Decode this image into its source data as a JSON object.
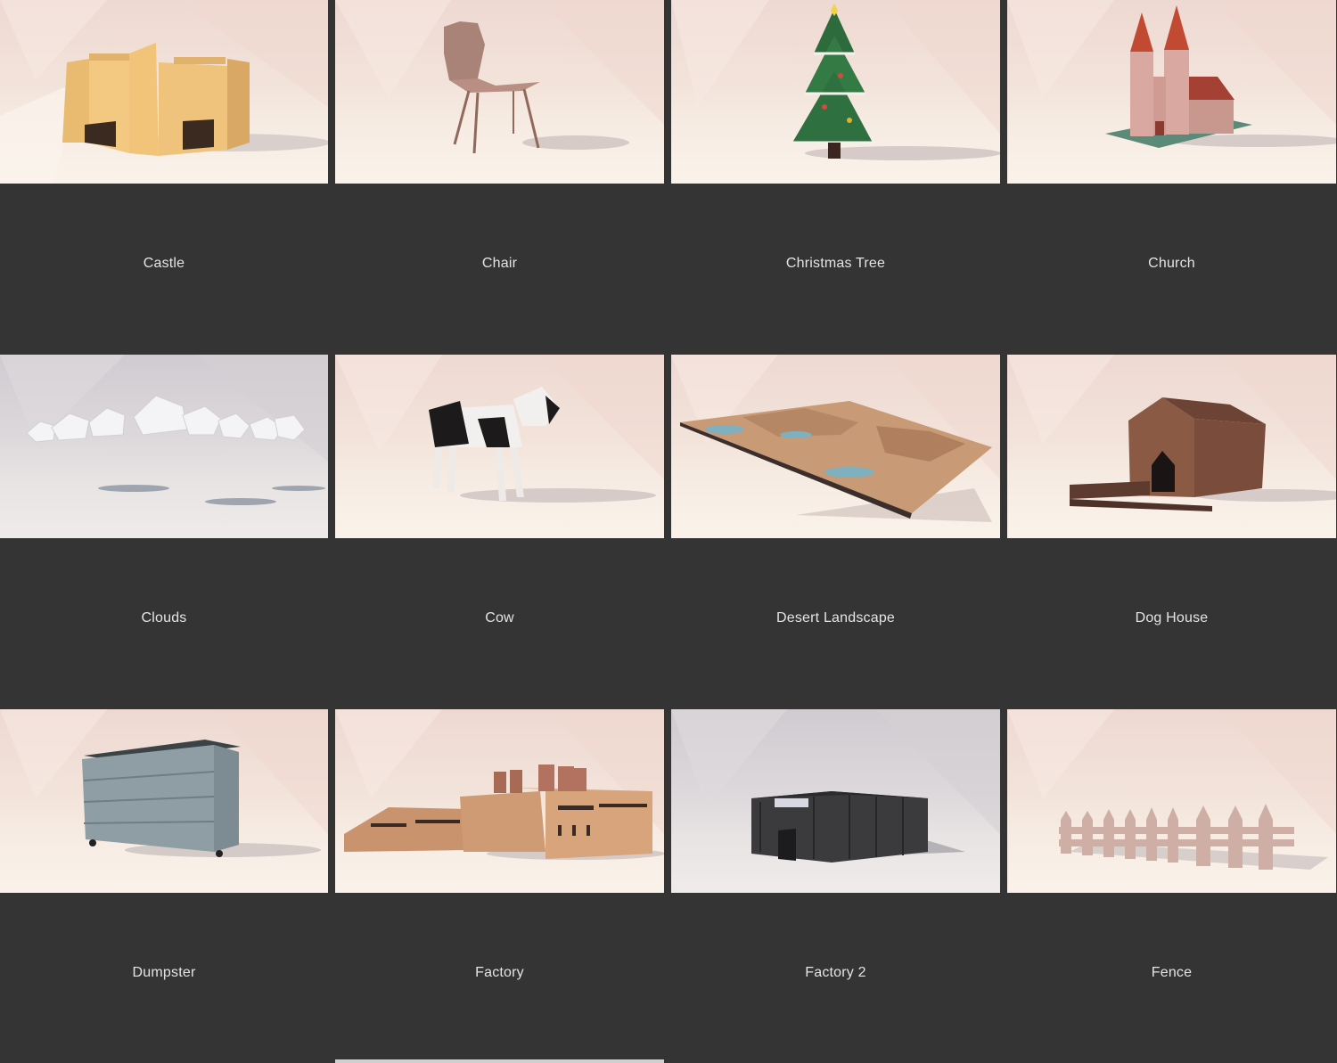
{
  "gallery": {
    "items": [
      {
        "label": "Castle",
        "model_icon": "castle-icon"
      },
      {
        "label": "Chair",
        "model_icon": "chair-icon"
      },
      {
        "label": "Christmas Tree",
        "model_icon": "christmas-tree-icon"
      },
      {
        "label": "Church",
        "model_icon": "church-icon"
      },
      {
        "label": "Clouds",
        "model_icon": "clouds-icon"
      },
      {
        "label": "Cow",
        "model_icon": "cow-icon"
      },
      {
        "label": "Desert Landscape",
        "model_icon": "desert-landscape-icon"
      },
      {
        "label": "Dog House",
        "model_icon": "dog-house-icon"
      },
      {
        "label": "Dumpster",
        "model_icon": "dumpster-icon"
      },
      {
        "label": "Factory",
        "model_icon": "factory-icon"
      },
      {
        "label": "Factory 2",
        "model_icon": "factory-2-icon"
      },
      {
        "label": "Fence",
        "model_icon": "fence-icon"
      }
    ]
  },
  "colors": {
    "background": "#343434",
    "label_text": "#e4e4e4",
    "thumb_warm": "#f2e3da",
    "thumb_cool": "#dcd8db"
  }
}
